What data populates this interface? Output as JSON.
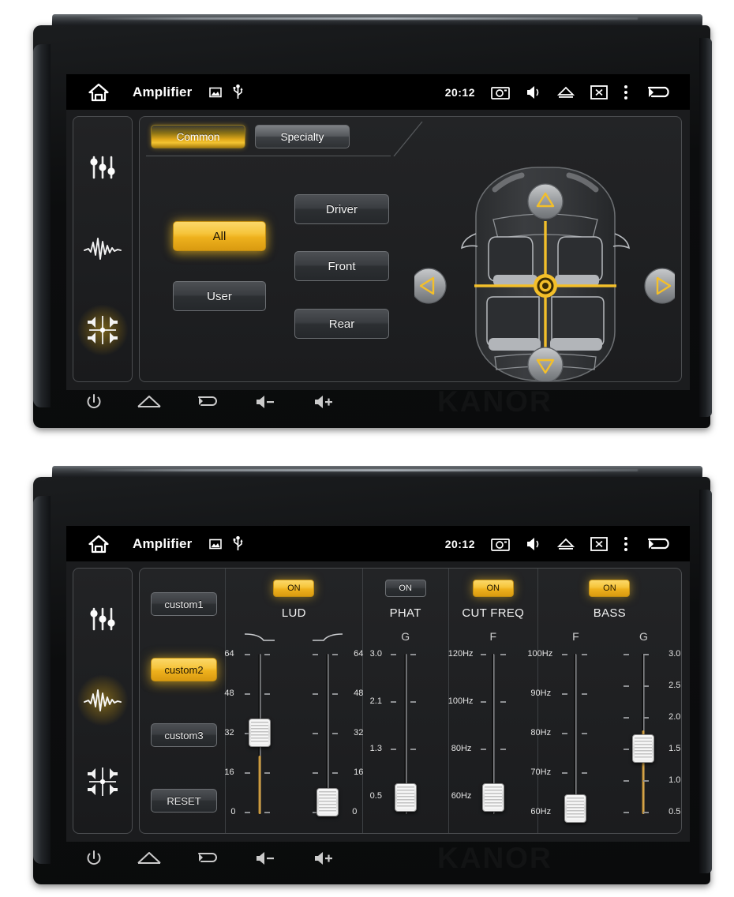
{
  "brand_watermark": "KANOR",
  "statusbar": {
    "title": "Amplifier",
    "clock": "20:12",
    "home_icon": "home-icon",
    "sd_icon": "sd-card-icon",
    "usb_icon": "usb-icon",
    "camera_icon": "screenshot-camera-icon",
    "mute_icon": "speaker-mute-icon",
    "eject_icon": "eject-icon",
    "closescreen_icon": "close-screen-icon",
    "overflow_icon": "overflow-menu-icon",
    "back_icon": "back-arrow-icon"
  },
  "hardware_nav": {
    "power": "power-icon",
    "home": "home-icon",
    "back": "back-icon",
    "vol_down": "volume-down-icon",
    "vol_up": "volume-up-icon"
  },
  "device1": {
    "sidebar": [
      {
        "name": "sidebar-item-equalizer-sliders",
        "icon": "faders-icon",
        "active": false
      },
      {
        "name": "sidebar-item-waveform",
        "icon": "waveform-icon",
        "active": false
      },
      {
        "name": "sidebar-item-balance-fader",
        "icon": "balance-speakers-icon",
        "active": true
      }
    ],
    "tabs": [
      {
        "label": "Common",
        "active": true
      },
      {
        "label": "Specialty",
        "active": false
      }
    ],
    "preset_buttons": [
      {
        "label": "All",
        "active": true
      },
      {
        "label": "User",
        "active": false
      }
    ],
    "position_buttons": [
      {
        "label": "Driver",
        "active": false
      },
      {
        "label": "Front",
        "active": false
      },
      {
        "label": "Rear",
        "active": false
      }
    ],
    "car_controls": {
      "up": "arrow-up-icon",
      "down": "arrow-down-icon",
      "left": "arrow-left-icon",
      "right": "arrow-right-icon",
      "center": "balance-center-target-icon"
    },
    "accent_color": "#f3bf2a"
  },
  "device2": {
    "sidebar": [
      {
        "name": "sidebar-item-equalizer-sliders",
        "icon": "faders-icon",
        "active": false
      },
      {
        "name": "sidebar-item-waveform",
        "icon": "waveform-icon",
        "active": true
      },
      {
        "name": "sidebar-item-balance-fader",
        "icon": "balance-speakers-icon",
        "active": false
      }
    ],
    "presets": [
      {
        "label": "custom1",
        "selected": false
      },
      {
        "label": "custom2",
        "selected": true
      },
      {
        "label": "custom3",
        "selected": false
      },
      {
        "label": "RESET",
        "selected": false
      }
    ],
    "columns": [
      {
        "title": "LUD",
        "on_label": "ON",
        "on": true,
        "sliders": [
          {
            "cap": "",
            "cap_icon": "curve-down-icon",
            "ticks": [
              "64",
              "48",
              "32",
              "16",
              "0"
            ],
            "labels_side": "left",
            "min": 0,
            "max": 64,
            "value": 30,
            "fill": true
          },
          {
            "cap": "",
            "cap_icon": "curve-up-icon",
            "ticks": [
              "64",
              "48",
              "32",
              "16",
              "0"
            ],
            "labels_side": "right",
            "min": 0,
            "max": 64,
            "value": 4,
            "fill": false
          }
        ]
      },
      {
        "title": "PHAT",
        "on_label": "ON",
        "on": false,
        "sliders": [
          {
            "cap": "G",
            "ticks": [
              "3.0",
              "2.1",
              "1.3",
              "0.5"
            ],
            "labels_side": "left",
            "min": 0.5,
            "max": 3.0,
            "value": 0.5,
            "fill": false
          }
        ]
      },
      {
        "title": "CUT FREQ",
        "on_label": "ON",
        "on": true,
        "sliders": [
          {
            "cap": "F",
            "ticks": [
              "120Hz",
              "100Hz",
              "80Hz",
              "60Hz"
            ],
            "labels_side": "left",
            "min": 60,
            "max": 120,
            "value": 60,
            "fill": false
          }
        ]
      },
      {
        "title": "BASS",
        "on_label": "ON",
        "on": true,
        "sliders": [
          {
            "cap": "F",
            "ticks": [
              "100Hz",
              "90Hz",
              "80Hz",
              "70Hz",
              "60Hz"
            ],
            "labels_side": "left",
            "min": 60,
            "max": 100,
            "value": 60,
            "fill": false
          },
          {
            "cap": "G",
            "ticks": [
              "3.0",
              "2.5",
              "2.0",
              "1.5",
              "1.0",
              "0.5"
            ],
            "labels_side": "right",
            "min": 0.5,
            "max": 3.0,
            "value": 1.6,
            "fill": true
          }
        ]
      }
    ],
    "accent_color": "#f3bf2a"
  }
}
